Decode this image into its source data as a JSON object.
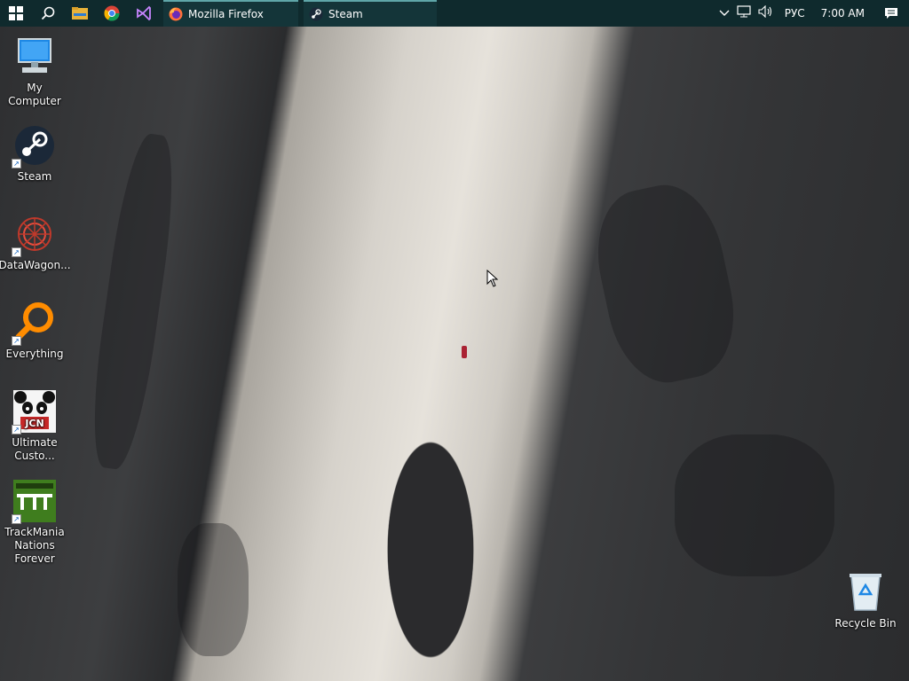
{
  "taskbar": {
    "start_icon": "windows-logo",
    "search_icon": "search-icon",
    "pinned": [
      {
        "name": "file-explorer-icon"
      },
      {
        "name": "chrome-icon"
      },
      {
        "name": "visual-studio-icon"
      }
    ],
    "tasks": [
      {
        "label": "Mozilla Firefox",
        "icon": "firefox-icon"
      },
      {
        "label": "Steam",
        "icon": "steam-icon"
      }
    ],
    "tray": {
      "language": "РУС",
      "time": "7:00 AM"
    },
    "colors": {
      "background": "#0f2a2d",
      "active_underline": "#5fa6a8"
    }
  },
  "desktop": {
    "icons": [
      {
        "label": "My Computer",
        "icon": "computer-icon"
      },
      {
        "label": "Steam",
        "icon": "steam-icon"
      },
      {
        "label": "DataWagon...",
        "icon": "datawagon-icon"
      },
      {
        "label": "Everything",
        "icon": "search-magnifier-icon"
      },
      {
        "label": "Ultimate Custo...",
        "icon": "jcn-panda-icon"
      },
      {
        "label": "TrackMania Nations Forever",
        "icon": "trackmania-icon"
      },
      {
        "label": "Recycle Bin",
        "icon": "recycle-bin-icon"
      }
    ]
  }
}
